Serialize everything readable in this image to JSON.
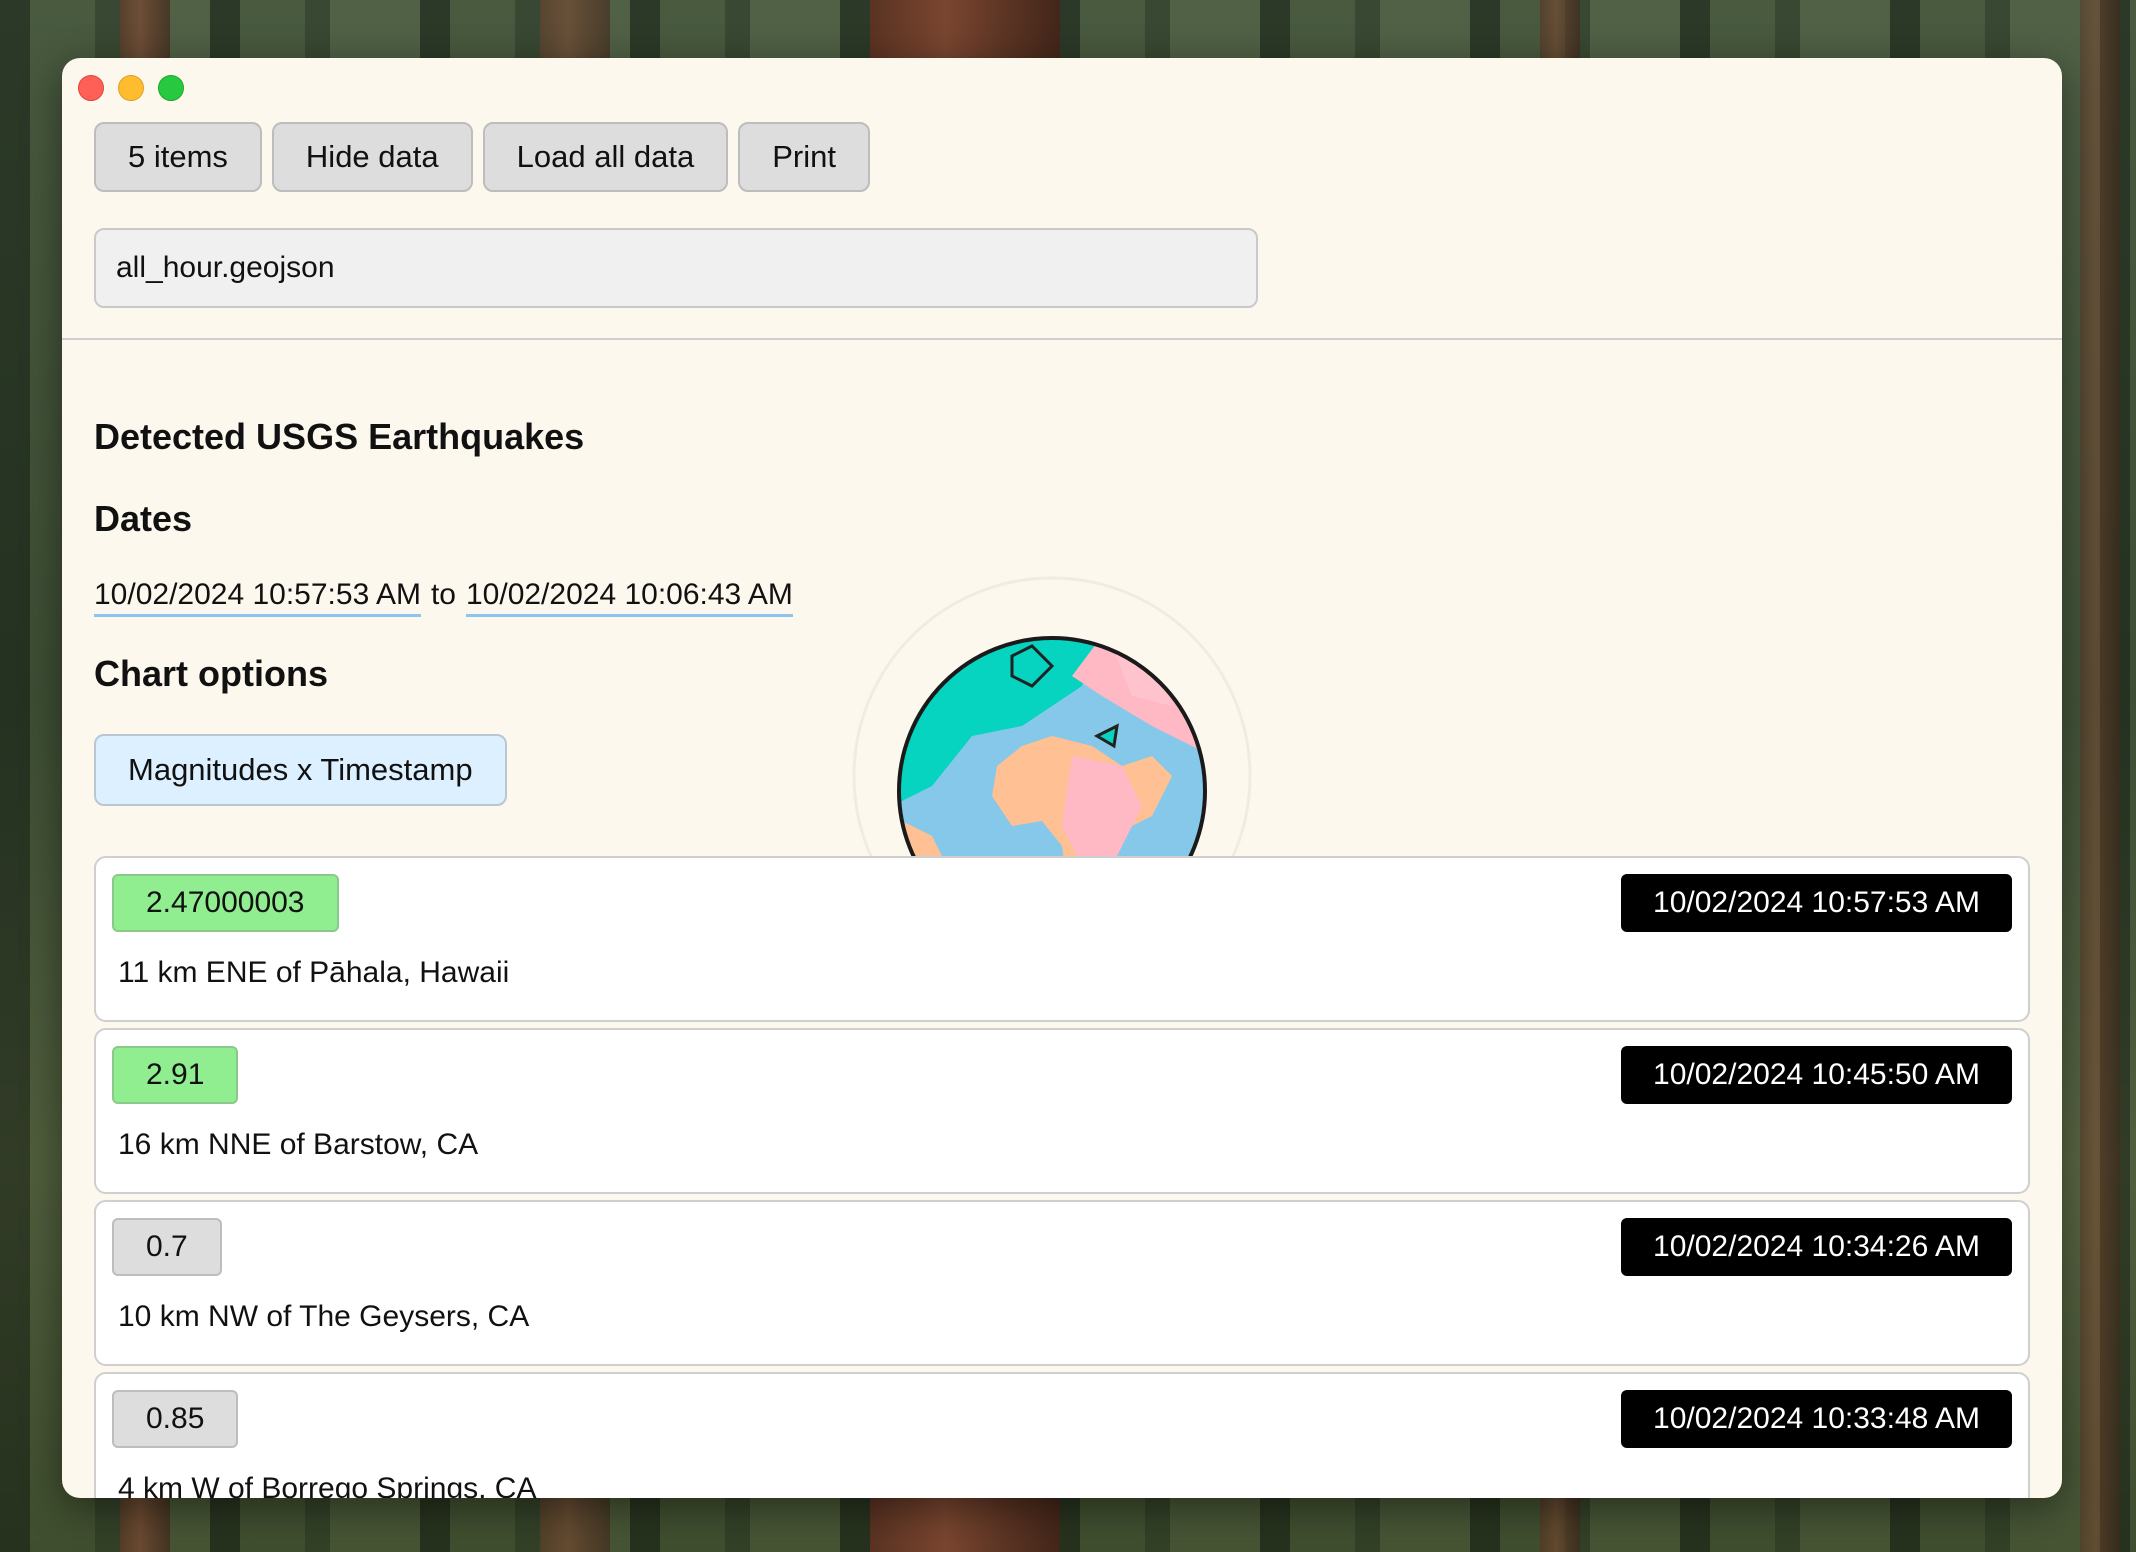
{
  "toolbar": {
    "items_label": "5 items",
    "hide_label": "Hide data",
    "load_label": "Load all data",
    "print_label": "Print"
  },
  "file_input": {
    "value": "all_hour.geojson"
  },
  "headings": {
    "title": "Detected USGS Earthquakes",
    "dates": "Dates",
    "chart_options": "Chart options"
  },
  "dates": {
    "from": "10/02/2024 10:57:53 AM",
    "connector": "to",
    "to": "10/02/2024 10:06:43 AM"
  },
  "chart_button": {
    "label": "Magnitudes x Timestamp"
  },
  "quakes": [
    {
      "magnitude": "2.47000003",
      "timestamp": "10/02/2024 10:57:53 AM",
      "place": "11 km ENE of Pāhala, Hawaii"
    },
    {
      "magnitude": "2.91",
      "timestamp": "10/02/2024 10:45:50 AM",
      "place": "16 km NNE of Barstow, CA"
    },
    {
      "magnitude": "0.7",
      "timestamp": "10/02/2024 10:34:26 AM",
      "place": "10 km NW of The Geysers, CA"
    },
    {
      "magnitude": "0.85",
      "timestamp": "10/02/2024 10:33:48 AM",
      "place": "4 km W of Borrego Springs, CA"
    }
  ],
  "colors": {
    "window_bg": "#fdf8ee",
    "magnitude_high": "#90ee90",
    "magnitude_low": "#dddddd",
    "timestamp_bg": "#000000",
    "chart_button_bg": "#dcf0ff",
    "date_underline": "#8ec5ec"
  }
}
